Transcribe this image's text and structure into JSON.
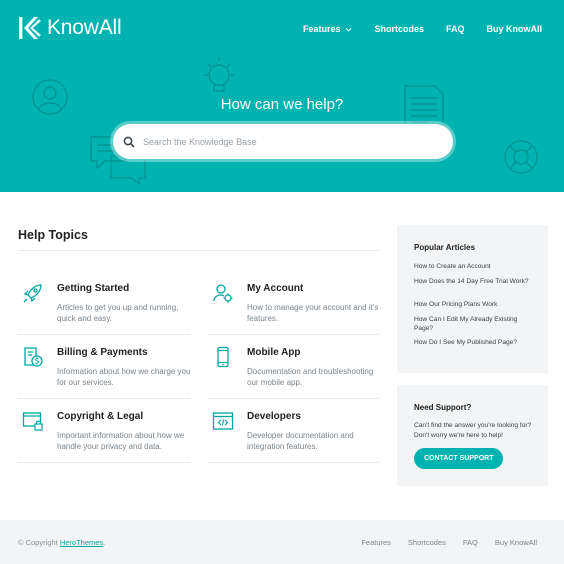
{
  "header": {
    "logo_text": "KnowAll",
    "nav": [
      {
        "label": "Features",
        "has_dropdown": true
      },
      {
        "label": "Shortcodes"
      },
      {
        "label": "FAQ"
      },
      {
        "label": "Buy KnowAll"
      }
    ]
  },
  "hero": {
    "title": "How can we help?",
    "search_placeholder": "Search the Knowledge Base",
    "search_value": ""
  },
  "help_topics": {
    "heading": "Help Topics",
    "topics": [
      {
        "icon": "rocket-icon",
        "title": "Getting Started",
        "description": "Articles to get you up and running, quick and easy."
      },
      {
        "icon": "user-gear-icon",
        "title": "My Account",
        "description": "How to manage your account and it's features."
      },
      {
        "icon": "invoice-dollar-icon",
        "title": "Billing & Payments",
        "description": "Information about how we charge you for our services."
      },
      {
        "icon": "mobile-phone-icon",
        "title": "Mobile App",
        "description": "Documentation and troubleshooting our mobile app."
      },
      {
        "icon": "browser-lock-icon",
        "title": "Copyright & Legal",
        "description": "Important information about how we handle your privacy and data."
      },
      {
        "icon": "code-window-icon",
        "title": "Developers",
        "description": "Developer documentation and integration features."
      }
    ]
  },
  "sidebar": {
    "popular": {
      "title": "Popular Articles",
      "articles": [
        "How to Create an Account",
        "How Does the 14 Day Free Trial Work?",
        "How Our Pricing Plans Work",
        "How Can I Edit My Already Existing Page?",
        "How Do I See My Published Page?"
      ]
    },
    "support": {
      "title": "Need Support?",
      "text": "Can't find the answer you're looking for? Don't worry we're here to help!",
      "button_label": "CONTACT SUPPORT"
    }
  },
  "footer": {
    "copyright_prefix": "© Copyright",
    "copyright_link": "HeroThemes",
    "copyright_suffix": ".",
    "links": [
      "Features",
      "Shortcodes",
      "FAQ",
      "Buy KnowAll"
    ]
  },
  "colors": {
    "brand": "#00b3b0",
    "footer_bg": "#f3f4f5",
    "sidebar_bg": "#f3f4f5"
  }
}
